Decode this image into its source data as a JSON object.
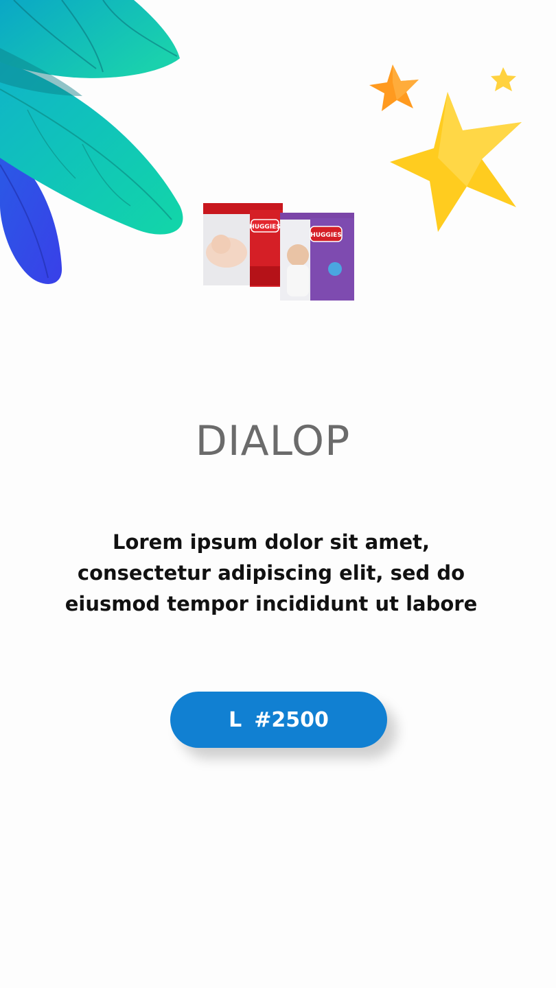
{
  "title": "DIALOP",
  "description": "Lorem ipsum dolor sit amet, consectetur adipiscing elit, sed do eiusmod tempor incididunt ut labore",
  "price_button": {
    "currency": "L",
    "amount": "#2500"
  },
  "product_image": {
    "brand_text": "HUGGIES"
  },
  "colors": {
    "accent": "#1180d2",
    "title_gray": "#6b6b6b",
    "leaf_teal": "#14c6b0",
    "leaf_blue": "#3147e6",
    "star_yellow": "#ffcc1f",
    "star_orange": "#ff9a1f"
  },
  "icons": {
    "decor_left": "leaves-illustration",
    "decor_right": "stars-illustration"
  }
}
